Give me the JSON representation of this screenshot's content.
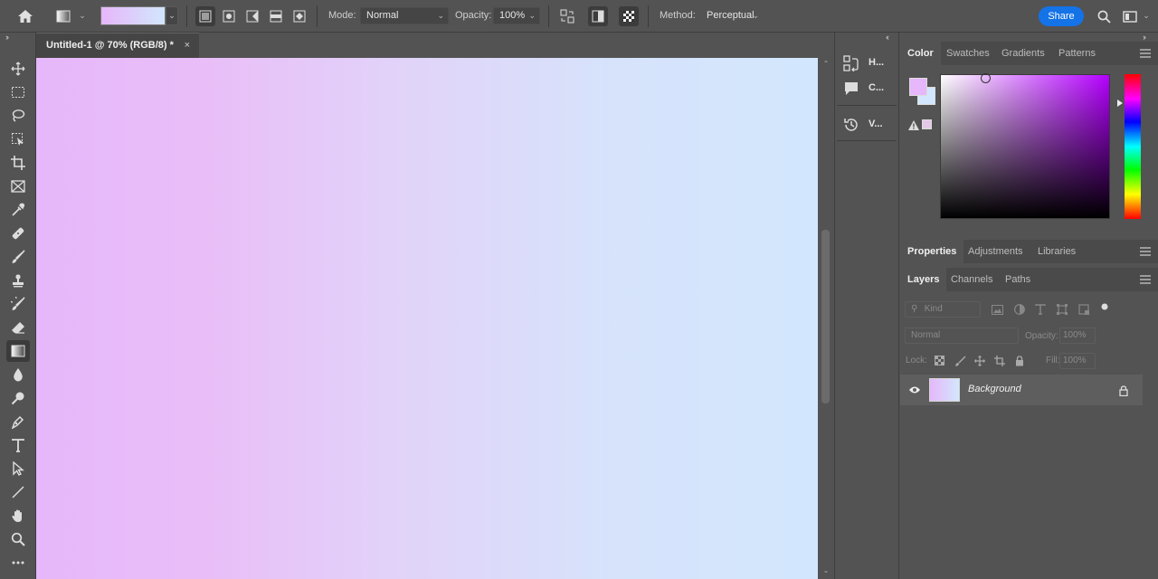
{
  "options_bar": {
    "mode_label": "Mode:",
    "mode_value": "Normal",
    "opacity_label": "Opacity:",
    "opacity_value": "100%",
    "method_label": "Method:",
    "method_value": "Perceptual",
    "share_label": "Share",
    "gradient_preset_colors": [
      "#e6b7fa",
      "#d2e7fd"
    ]
  },
  "document": {
    "tab_title": "Untitled-1 @ 70% (RGB/8) *",
    "close_glyph": "×",
    "gradient_start_color": "#e6b7fa",
    "gradient_end_color": "#d2e7fd"
  },
  "collapsed_panels": {
    "items": [
      {
        "label": "H...",
        "icon": "history-brush-icon"
      },
      {
        "label": "C...",
        "icon": "comments-icon"
      },
      {
        "label": "V...",
        "icon": "version-history-icon"
      }
    ]
  },
  "color_panel": {
    "tabs": [
      "Color",
      "Swatches",
      "Gradients",
      "Patterns"
    ],
    "active_tab": "Color",
    "foreground_color": "#e6b7fa",
    "background_color": "#d2e7fd"
  },
  "properties_panel": {
    "tabs": [
      "Properties",
      "Adjustments",
      "Libraries"
    ],
    "active_tab": "Properties"
  },
  "layers_panel": {
    "tabs": [
      "Layers",
      "Channels",
      "Paths"
    ],
    "active_tab": "Layers",
    "filter_placeholder": "Kind",
    "blend_mode": "Normal",
    "opacity_label": "Opacity:",
    "opacity_value": "100%",
    "lock_label": "Lock:",
    "fill_label": "Fill:",
    "fill_value": "100%",
    "layers": [
      {
        "name": "Background",
        "visible": true,
        "locked": true
      }
    ]
  }
}
